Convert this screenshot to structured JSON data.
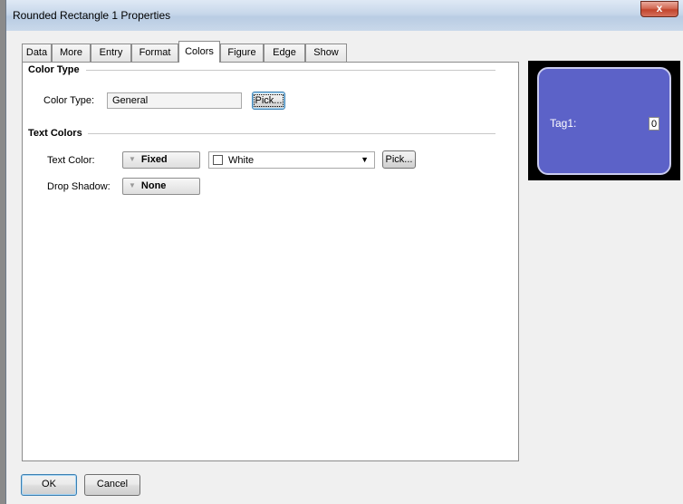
{
  "window": {
    "title": "Rounded Rectangle 1 Properties",
    "close_glyph": "x"
  },
  "tabs": [
    {
      "label": "Data"
    },
    {
      "label": "More"
    },
    {
      "label": "Entry"
    },
    {
      "label": "Format"
    },
    {
      "label": "Colors",
      "active": true
    },
    {
      "label": "Figure"
    },
    {
      "label": "Edge"
    },
    {
      "label": "Show"
    }
  ],
  "color_type": {
    "section_title": "Color Type",
    "label": "Color Type:",
    "value": "General",
    "pick_label": "Pick..."
  },
  "text_colors": {
    "section_title": "Text Colors",
    "text_color_label": "Text Color:",
    "text_color_mode": "Fixed",
    "text_color_value": "White",
    "text_color_swatch": "#ffffff",
    "pick_label": "Pick...",
    "drop_shadow_label": "Drop Shadow:",
    "drop_shadow_mode": "None"
  },
  "preview": {
    "label": "Tag1:",
    "value": "0",
    "shape_fill": "#5c62c8",
    "background": "#000000"
  },
  "footer": {
    "ok_label": "OK",
    "cancel_label": "Cancel"
  }
}
